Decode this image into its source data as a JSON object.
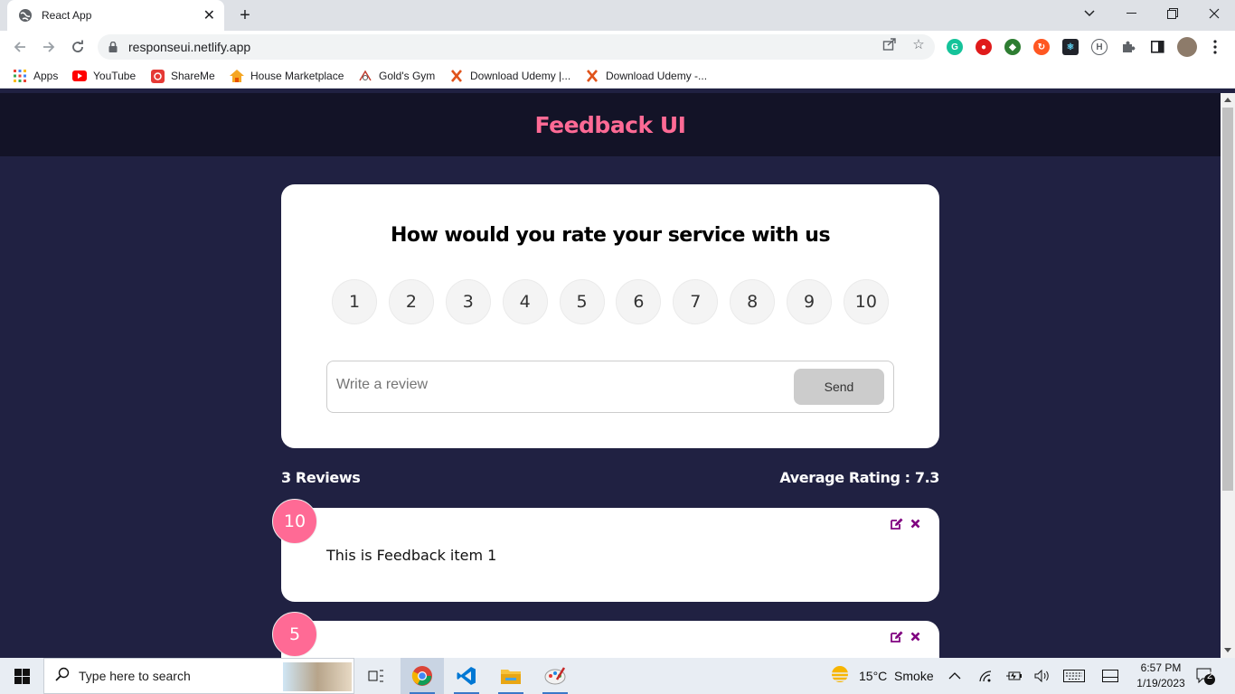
{
  "browser": {
    "tab_title": "React App",
    "url": "responseui.netlify.app",
    "bookmarks": [
      {
        "label": "Apps",
        "icon": "apps-grid-icon"
      },
      {
        "label": "YouTube",
        "icon": "youtube-icon"
      },
      {
        "label": "ShareMe",
        "icon": "shareme-icon"
      },
      {
        "label": "House Marketplace",
        "icon": "house-icon"
      },
      {
        "label": "Gold's Gym",
        "icon": "gym-icon"
      },
      {
        "label": "Download Udemy |...",
        "icon": "x-logo-icon"
      },
      {
        "label": "Download Udemy -...",
        "icon": "x-logo-icon"
      }
    ]
  },
  "app": {
    "title": "Feedback UI",
    "form": {
      "heading": "How would you rate your service with us",
      "ratings": [
        "1",
        "2",
        "3",
        "4",
        "5",
        "6",
        "7",
        "8",
        "9",
        "10"
      ],
      "placeholder": "Write a review",
      "send_label": "Send"
    },
    "stats": {
      "count_label": "3 Reviews",
      "average_label": "Average Rating : 7.3"
    },
    "feedback": [
      {
        "rating": "10",
        "text": "This is Feedback item 1"
      },
      {
        "rating": "5",
        "text": ""
      }
    ]
  },
  "taskbar": {
    "search_placeholder": "Type here to search",
    "weather": "15°C  Smoke",
    "time": "6:57 PM",
    "date": "1/19/2023",
    "notifications": "2"
  },
  "colors": {
    "accent": "#ff6a95",
    "page_bg": "#202142",
    "icon_purple": "#800080"
  }
}
